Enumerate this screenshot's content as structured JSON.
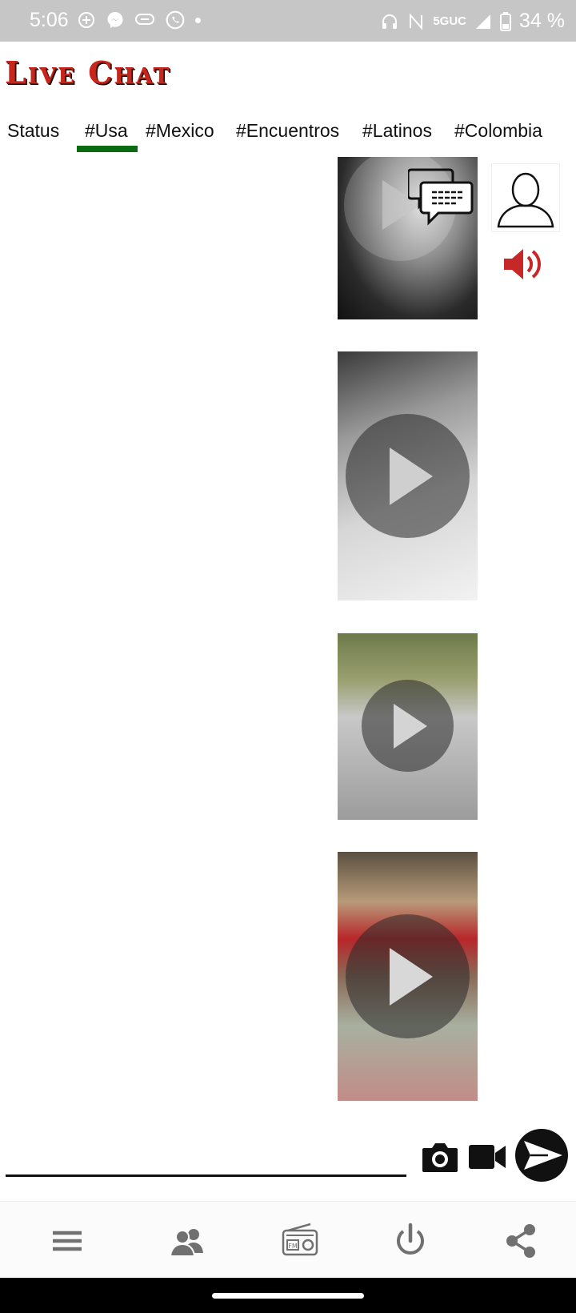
{
  "status_bar": {
    "time": "5:06",
    "network": "5GUC",
    "battery": "34 %",
    "icons": [
      "add-circle-icon",
      "messenger-icon",
      "chat-bubble-icon",
      "whatsapp-icon",
      "dot-icon",
      "headset-icon",
      "nfc-icon",
      "signal-icon",
      "battery-icon"
    ]
  },
  "header": {
    "logo": "Live Chat"
  },
  "tabs": [
    {
      "label": "Status"
    },
    {
      "label": "#Usa",
      "selected": true
    },
    {
      "label": "#Mexico"
    },
    {
      "label": "#Encuentros"
    },
    {
      "label": "#Latinos"
    },
    {
      "label": "#Colombia"
    }
  ],
  "feed": {
    "items": [
      "video",
      "video",
      "video",
      "video"
    ],
    "icons": [
      "chat-icon",
      "user-profile-icon",
      "volume-icon"
    ]
  },
  "composer": {
    "icons": [
      "camera-icon",
      "video-camera-icon",
      "send-icon"
    ]
  },
  "bottom_nav": {
    "icons": [
      "menu-icon",
      "users-icon",
      "radio-icon",
      "power-icon",
      "share-icon"
    ]
  },
  "colors": {
    "accent": "#0b6b10",
    "logo": "#c8261a",
    "volume": "#c62828",
    "status_bar": "#c6c6c6"
  }
}
